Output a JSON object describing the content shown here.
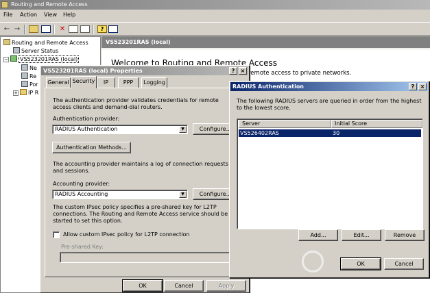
{
  "main_window": {
    "title": "Routing and Remote Access",
    "menu": [
      "File",
      "Action",
      "View",
      "Help"
    ],
    "toolbar_icons": [
      "back-icon",
      "forward-icon",
      "up-folder-icon",
      "show-tree-icon",
      "delete-icon",
      "properties-icon",
      "export-icon",
      "refresh-icon",
      "help-icon",
      "console-icon"
    ]
  },
  "tree": {
    "root": "Routing and Remote Access",
    "server_status": "Server Status",
    "server": "VS523201RAS (local)",
    "children": [
      "Ne",
      "Re",
      "Por",
      "IP R"
    ]
  },
  "right_pane": {
    "header": "VS523201RAS (local)",
    "welcome_title": "Welcome to Routing and Remote Access",
    "welcome_text": "remote access to private networks."
  },
  "properties_dialog": {
    "title": "VS523201RAS (local) Properties",
    "tabs": [
      "General",
      "Security",
      "IP",
      "PPP",
      "Logging"
    ],
    "selected_tab": "Security",
    "auth_description": "The authentication provider validates credentials for remote access clients and demand-dial routers.",
    "auth_provider_label": "Authentication provider:",
    "auth_provider_value": "RADIUS Authentication",
    "configure_label": "Configure...",
    "auth_methods_label": "Authentication Methods...",
    "accounting_description": "The accounting provider maintains a log of connection requests and sessions.",
    "accounting_provider_label": "Accounting provider:",
    "accounting_provider_value": "RADIUS Accounting",
    "ipsec_description": "The custom IPsec policy specifies a pre-shared key for L2TP connections. The Routing and Remote Access service should be started to set this option.",
    "allow_ipsec_label": "Allow custom IPsec policy for L2TP connection",
    "preshared_key_label": "Pre-shared Key:",
    "ok_label": "OK",
    "cancel_label": "Cancel",
    "apply_label": "Apply"
  },
  "radius_dialog": {
    "title": "RADIUS Authentication",
    "description": "The following RADIUS servers are queried in order from the highest to the lowest score.",
    "columns": [
      "Server",
      "Initial Score"
    ],
    "rows": [
      {
        "server": "VS526402RAS",
        "score": "30"
      }
    ],
    "add_label": "Add...",
    "edit_label": "Edit...",
    "remove_label": "Remove",
    "ok_label": "OK",
    "cancel_label": "Cancel"
  },
  "colors": {
    "active_title": "#0a246a",
    "inactive_title": "#808080",
    "dialog_bg": "#d4d0c8",
    "selection": "#0a246a"
  }
}
